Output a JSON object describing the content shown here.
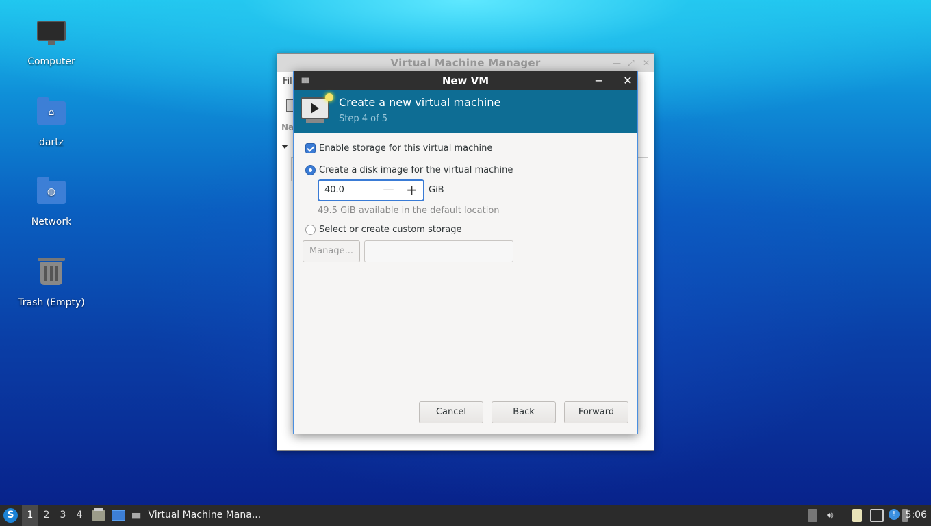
{
  "desktop": {
    "icons": [
      {
        "label": "Computer"
      },
      {
        "label": "dartz"
      },
      {
        "label": "Network"
      },
      {
        "label": "Trash (Empty)"
      }
    ]
  },
  "background_window": {
    "title": "Virtual Machine Manager",
    "menu_first": "Fil",
    "column_header": "Na"
  },
  "dialog": {
    "title": "New VM",
    "minimize_glyph": "−",
    "close_glyph": "✕",
    "header_title": "Create a new virtual machine",
    "header_step": "Step 4 of 5",
    "enable_storage_label": "Enable storage for this virtual machine",
    "enable_storage_checked": true,
    "create_disk_label": "Create a disk image for the virtual machine",
    "disk_size_value": "40.0",
    "disk_size_unit": "GiB",
    "decrement_glyph": "—",
    "increment_glyph": "+",
    "available_hint": "49.5 GiB available in the default location",
    "custom_storage_label": "Select or create custom storage",
    "manage_button": "Manage...",
    "custom_storage_path": "",
    "cancel_button": "Cancel",
    "back_button": "Back",
    "forward_button": "Forward",
    "selected_option": "create_disk"
  },
  "taskbar": {
    "start_glyph": "S",
    "workspaces": [
      "1",
      "2",
      "3",
      "4"
    ],
    "active_workspace": "1",
    "task_label": "Virtual Machine Mana...",
    "clock": "5:06"
  },
  "colors": {
    "accent": "#3a7bd5",
    "banner": "#0e6d94",
    "titlebar": "#2f2f2f",
    "taskbar": "#2b2b2b"
  }
}
